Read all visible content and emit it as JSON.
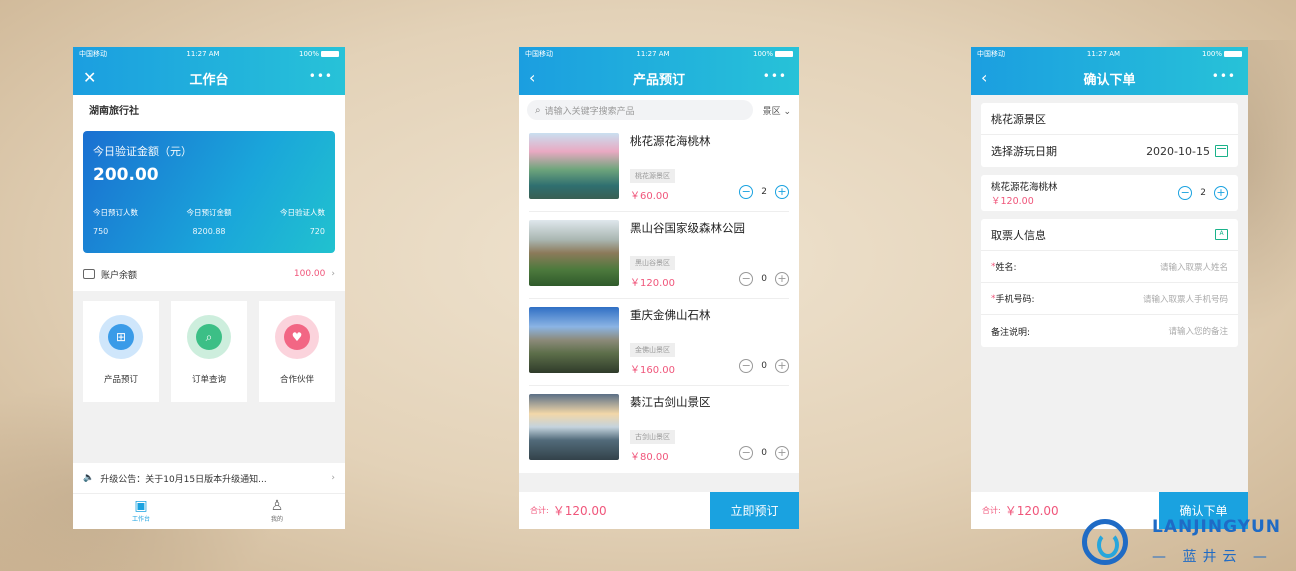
{
  "colors": {
    "accent": "#1aa2e0",
    "price": "#f0567b",
    "bg": "#e8d9c2"
  },
  "status": {
    "carrier": "中国移动",
    "time": "11:27 AM",
    "battery": "100%"
  },
  "screen1": {
    "title": "工作台",
    "left_icon": "close-icon",
    "more": "•••",
    "agency": "湖南旅行社",
    "card": {
      "label": "今日验证金额（元）",
      "amount": "200.00",
      "stats": [
        {
          "label": "今日预订人数",
          "value": "750"
        },
        {
          "label": "今日预订金额",
          "value": "8200.88"
        },
        {
          "label": "今日验证人数",
          "value": "720"
        }
      ]
    },
    "balance": {
      "label": "账户余额",
      "value": "100.00"
    },
    "tiles": [
      {
        "label": "产品预订",
        "icon": "product-booking-icon"
      },
      {
        "label": "订单查询",
        "icon": "order-query-icon"
      },
      {
        "label": "合作伙伴",
        "icon": "partner-icon"
      }
    ],
    "notice": "升级公告：关于10月15日版本升级通知...",
    "tabs": [
      {
        "label": "工作台",
        "icon": "workbench-icon"
      },
      {
        "label": "我的",
        "icon": "profile-icon"
      }
    ]
  },
  "screen2": {
    "title": "产品预订",
    "more": "•••",
    "search_placeholder": "请输入关键字搜索产品",
    "filter": "景区",
    "products": [
      {
        "name": "桃花源花海桃林",
        "tag": "桃花源景区",
        "price": "￥60.00",
        "qty": "2"
      },
      {
        "name": "黑山谷国家级森林公园",
        "tag": "黑山谷景区",
        "price": "￥120.00",
        "qty": "0"
      },
      {
        "name": "重庆金佛山石林",
        "tag": "金佛山景区",
        "price": "￥160.00",
        "qty": "0"
      },
      {
        "name": "綦江古剑山景区",
        "tag": "古剑山景区",
        "price": "￥80.00",
        "qty": "0"
      }
    ],
    "total_label": "合计:",
    "total_value": "￥120.00",
    "submit": "立即预订"
  },
  "screen3": {
    "title": "确认下单",
    "more": "•••",
    "scenic": "桃花源景区",
    "date_label": "选择游玩日期",
    "date_value": "2020-10-15",
    "ticket_name": "桃花源花海桃林",
    "ticket_price": "￥120.00",
    "ticket_qty": "2",
    "contact_title": "取票人信息",
    "fields": [
      {
        "label": "姓名:",
        "placeholder": "请输入取票人姓名",
        "required": true
      },
      {
        "label": "手机号码:",
        "placeholder": "请输入取票人手机号码",
        "required": true
      },
      {
        "label": "备注说明:",
        "placeholder": "请输入您的备注",
        "required": false
      }
    ],
    "total_label": "合计:",
    "total_value": "￥120.00",
    "submit": "确认下单"
  },
  "logo": {
    "en": "LANJINGYUN",
    "cn": "— 蓝井云 —"
  }
}
